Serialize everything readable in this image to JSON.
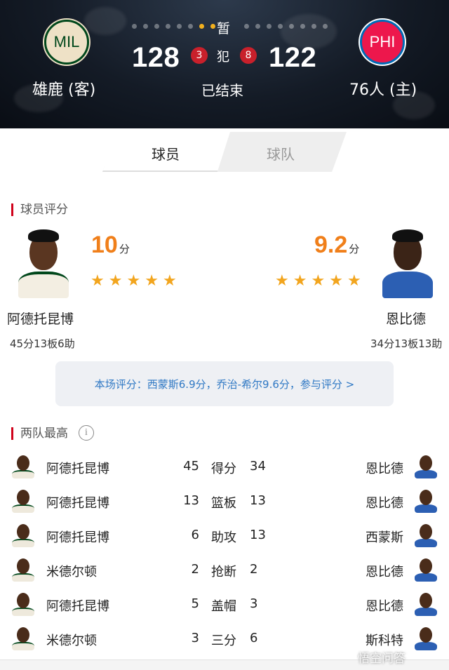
{
  "scoreboard": {
    "home": {
      "abbr": "MIL",
      "name": "雄鹿 (客)",
      "score": "128",
      "fouls": "3"
    },
    "away": {
      "abbr": "PHI",
      "name": "76人 (主)",
      "score": "122",
      "fouls": "8"
    },
    "timeout_label": "暂",
    "foul_label": "犯",
    "status": "已结束",
    "colors": {
      "home_primary": "#00471b",
      "home_secondary": "#eee1c6",
      "away_primary": "#ed174c",
      "away_secondary": "#006bb6",
      "timeout_dot_on": "#f2b01e"
    }
  },
  "tabs": [
    {
      "label": "球员",
      "active": true
    },
    {
      "label": "球队",
      "active": false
    }
  ],
  "player_rating": {
    "section_title": "球员评分",
    "home_player": {
      "name": "阿德托昆博",
      "rating": "10",
      "rating_unit": "分",
      "stars": 5,
      "statline": "45分13板6助"
    },
    "away_player": {
      "name": "恩比德",
      "rating": "9.2",
      "rating_unit": "分",
      "stars": 5,
      "statline": "34分13板13助"
    },
    "summary_link": "本场评分：西蒙斯6.9分，乔治-希尔9.6分，参与评分 >",
    "accent_color": "#f07f1a",
    "star_color": "#f2a51e"
  },
  "leaders": {
    "section_title": "两队最高",
    "info_icon": "info-icon",
    "rows": [
      {
        "home_name": "阿德托昆博",
        "home_value": "45",
        "category": "得分",
        "away_value": "34",
        "away_name": "恩比德"
      },
      {
        "home_name": "阿德托昆博",
        "home_value": "13",
        "category": "篮板",
        "away_value": "13",
        "away_name": "恩比德"
      },
      {
        "home_name": "阿德托昆博",
        "home_value": "6",
        "category": "助攻",
        "away_value": "13",
        "away_name": "西蒙斯"
      },
      {
        "home_name": "米德尔顿",
        "home_value": "2",
        "category": "抢断",
        "away_value": "2",
        "away_name": "恩比德"
      },
      {
        "home_name": "阿德托昆博",
        "home_value": "5",
        "category": "盖帽",
        "away_value": "3",
        "away_name": "恩比德"
      },
      {
        "home_name": "米德尔顿",
        "home_value": "3",
        "category": "三分",
        "away_value": "6",
        "away_name": "斯科特"
      }
    ]
  },
  "watermark": "悟空问答"
}
